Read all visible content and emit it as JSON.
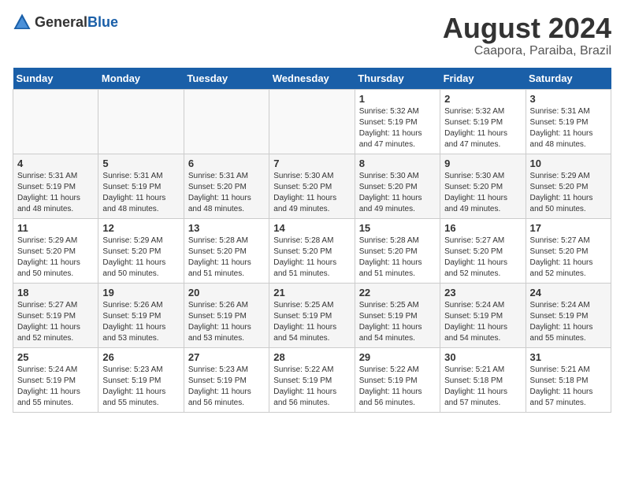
{
  "header": {
    "logo_general": "General",
    "logo_blue": "Blue",
    "title": "August 2024",
    "subtitle": "Caapora, Paraiba, Brazil"
  },
  "calendar": {
    "days_of_week": [
      "Sunday",
      "Monday",
      "Tuesday",
      "Wednesday",
      "Thursday",
      "Friday",
      "Saturday"
    ],
    "weeks": [
      [
        {
          "day": "",
          "info": ""
        },
        {
          "day": "",
          "info": ""
        },
        {
          "day": "",
          "info": ""
        },
        {
          "day": "",
          "info": ""
        },
        {
          "day": "1",
          "info": "Sunrise: 5:32 AM\nSunset: 5:19 PM\nDaylight: 11 hours and 47 minutes."
        },
        {
          "day": "2",
          "info": "Sunrise: 5:32 AM\nSunset: 5:19 PM\nDaylight: 11 hours and 47 minutes."
        },
        {
          "day": "3",
          "info": "Sunrise: 5:31 AM\nSunset: 5:19 PM\nDaylight: 11 hours and 48 minutes."
        }
      ],
      [
        {
          "day": "4",
          "info": "Sunrise: 5:31 AM\nSunset: 5:19 PM\nDaylight: 11 hours and 48 minutes."
        },
        {
          "day": "5",
          "info": "Sunrise: 5:31 AM\nSunset: 5:19 PM\nDaylight: 11 hours and 48 minutes."
        },
        {
          "day": "6",
          "info": "Sunrise: 5:31 AM\nSunset: 5:20 PM\nDaylight: 11 hours and 48 minutes."
        },
        {
          "day": "7",
          "info": "Sunrise: 5:30 AM\nSunset: 5:20 PM\nDaylight: 11 hours and 49 minutes."
        },
        {
          "day": "8",
          "info": "Sunrise: 5:30 AM\nSunset: 5:20 PM\nDaylight: 11 hours and 49 minutes."
        },
        {
          "day": "9",
          "info": "Sunrise: 5:30 AM\nSunset: 5:20 PM\nDaylight: 11 hours and 49 minutes."
        },
        {
          "day": "10",
          "info": "Sunrise: 5:29 AM\nSunset: 5:20 PM\nDaylight: 11 hours and 50 minutes."
        }
      ],
      [
        {
          "day": "11",
          "info": "Sunrise: 5:29 AM\nSunset: 5:20 PM\nDaylight: 11 hours and 50 minutes."
        },
        {
          "day": "12",
          "info": "Sunrise: 5:29 AM\nSunset: 5:20 PM\nDaylight: 11 hours and 50 minutes."
        },
        {
          "day": "13",
          "info": "Sunrise: 5:28 AM\nSunset: 5:20 PM\nDaylight: 11 hours and 51 minutes."
        },
        {
          "day": "14",
          "info": "Sunrise: 5:28 AM\nSunset: 5:20 PM\nDaylight: 11 hours and 51 minutes."
        },
        {
          "day": "15",
          "info": "Sunrise: 5:28 AM\nSunset: 5:20 PM\nDaylight: 11 hours and 51 minutes."
        },
        {
          "day": "16",
          "info": "Sunrise: 5:27 AM\nSunset: 5:20 PM\nDaylight: 11 hours and 52 minutes."
        },
        {
          "day": "17",
          "info": "Sunrise: 5:27 AM\nSunset: 5:20 PM\nDaylight: 11 hours and 52 minutes."
        }
      ],
      [
        {
          "day": "18",
          "info": "Sunrise: 5:27 AM\nSunset: 5:19 PM\nDaylight: 11 hours and 52 minutes."
        },
        {
          "day": "19",
          "info": "Sunrise: 5:26 AM\nSunset: 5:19 PM\nDaylight: 11 hours and 53 minutes."
        },
        {
          "day": "20",
          "info": "Sunrise: 5:26 AM\nSunset: 5:19 PM\nDaylight: 11 hours and 53 minutes."
        },
        {
          "day": "21",
          "info": "Sunrise: 5:25 AM\nSunset: 5:19 PM\nDaylight: 11 hours and 54 minutes."
        },
        {
          "day": "22",
          "info": "Sunrise: 5:25 AM\nSunset: 5:19 PM\nDaylight: 11 hours and 54 minutes."
        },
        {
          "day": "23",
          "info": "Sunrise: 5:24 AM\nSunset: 5:19 PM\nDaylight: 11 hours and 54 minutes."
        },
        {
          "day": "24",
          "info": "Sunrise: 5:24 AM\nSunset: 5:19 PM\nDaylight: 11 hours and 55 minutes."
        }
      ],
      [
        {
          "day": "25",
          "info": "Sunrise: 5:24 AM\nSunset: 5:19 PM\nDaylight: 11 hours and 55 minutes."
        },
        {
          "day": "26",
          "info": "Sunrise: 5:23 AM\nSunset: 5:19 PM\nDaylight: 11 hours and 55 minutes."
        },
        {
          "day": "27",
          "info": "Sunrise: 5:23 AM\nSunset: 5:19 PM\nDaylight: 11 hours and 56 minutes."
        },
        {
          "day": "28",
          "info": "Sunrise: 5:22 AM\nSunset: 5:19 PM\nDaylight: 11 hours and 56 minutes."
        },
        {
          "day": "29",
          "info": "Sunrise: 5:22 AM\nSunset: 5:19 PM\nDaylight: 11 hours and 56 minutes."
        },
        {
          "day": "30",
          "info": "Sunrise: 5:21 AM\nSunset: 5:18 PM\nDaylight: 11 hours and 57 minutes."
        },
        {
          "day": "31",
          "info": "Sunrise: 5:21 AM\nSunset: 5:18 PM\nDaylight: 11 hours and 57 minutes."
        }
      ]
    ]
  }
}
